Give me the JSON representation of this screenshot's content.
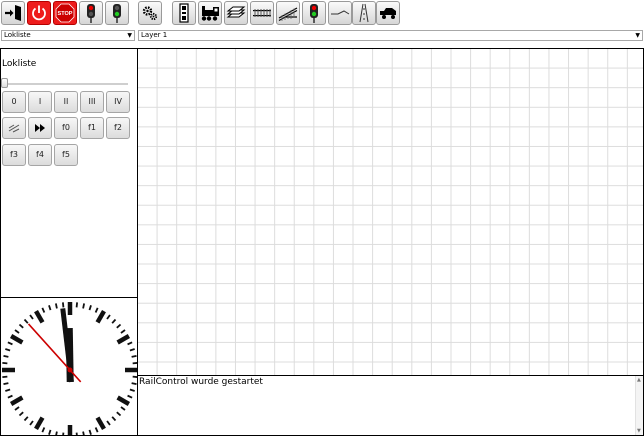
{
  "toolbar": {
    "buttons": [
      {
        "icon": "exit-icon"
      },
      {
        "icon": "power-icon",
        "color": "#ee1c1c"
      },
      {
        "icon": "stop-icon",
        "label": "STOP",
        "color": "#ee1c1c"
      },
      {
        "icon": "signal-red-icon"
      },
      {
        "icon": "signal-green-icon"
      },
      {
        "icon": "settings-gears-icon"
      },
      {
        "icon": "control-box-icon"
      },
      {
        "icon": "locomotive-icon"
      },
      {
        "icon": "layers-icon"
      },
      {
        "icon": "track-icon"
      },
      {
        "icon": "switch-icon"
      },
      {
        "icon": "signal-icon"
      },
      {
        "icon": "route-icon"
      },
      {
        "icon": "feedback-icon"
      },
      {
        "icon": "car-icon"
      }
    ]
  },
  "selectors": {
    "loco_select": "Lokliste",
    "layer_select": "Layer 1"
  },
  "loco_panel": {
    "title": "Lokliste",
    "speed_level": 0,
    "function_buttons": [
      "0",
      "I",
      "II",
      "III",
      "IV",
      "",
      "",
      "f0",
      "f1",
      "f2",
      "f3",
      "f4",
      "f5"
    ],
    "function_icons": [
      "",
      "",
      "",
      "",
      "",
      "direction-icon",
      "fast-forward-icon"
    ]
  },
  "log": {
    "text": "RailControl wurde gestartet"
  },
  "clock": {
    "hour": 11,
    "minute": 58,
    "second": 53
  },
  "colors": {
    "accent_red": "#ee1c1c",
    "grid": "#dcdcdc"
  }
}
